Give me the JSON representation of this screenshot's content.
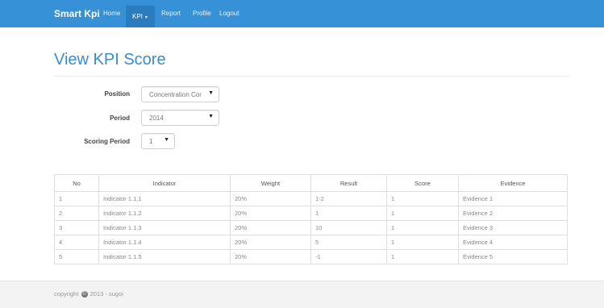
{
  "navbar": {
    "brand": "Smart Kpi",
    "items": [
      {
        "label": "Home"
      },
      {
        "label": "KPI"
      },
      {
        "label": "Report"
      },
      {
        "label": "Profile"
      },
      {
        "label": "Logout"
      }
    ],
    "active_item": "KPI",
    "colors": {
      "background": "#3791d6",
      "active": "#2a7cbf"
    }
  },
  "page": {
    "title": "View KPI Score"
  },
  "form": {
    "position": {
      "label": "Position",
      "value": "Concentration Cor"
    },
    "period": {
      "label": "Period",
      "value": "2014"
    },
    "scoring_period": {
      "label": "Scoring Period",
      "value": "1"
    }
  },
  "table": {
    "headers": [
      "No",
      "Indicator",
      "Weight",
      "Result",
      "Score",
      "Evidence"
    ],
    "rows": [
      [
        "1",
        "Indicator 1.1.1",
        "20%",
        "1-2",
        "1",
        "Evidence 1"
      ],
      [
        "2",
        "Indicator 1.1.2",
        "20%",
        "1",
        "1",
        "Evidence 2"
      ],
      [
        "3",
        "Indicator 1.1.3",
        "20%",
        "10",
        "1",
        "Evidence 3"
      ],
      [
        "4",
        "Indicator 1.1.4",
        "20%",
        "5",
        "1",
        "Evidence 4"
      ],
      [
        "5",
        "Indicator 1.1.5",
        "20%",
        "-1",
        "1",
        "Evidence 5"
      ]
    ]
  },
  "footer": {
    "prefix": "copyright",
    "suffix": "2013 - sugoi",
    "icon": "copyright-icon"
  }
}
